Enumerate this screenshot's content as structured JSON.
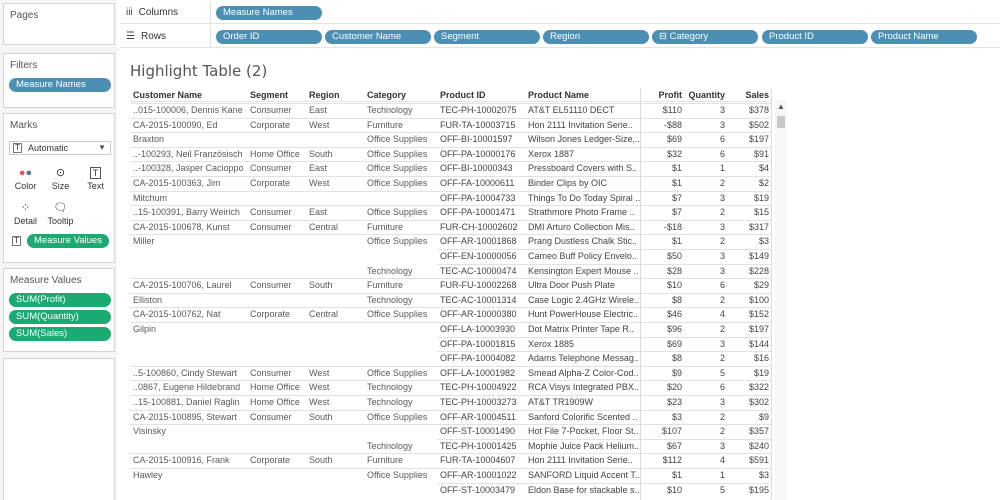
{
  "pages": {
    "title": "Pages"
  },
  "filters": {
    "title": "Filters",
    "pill": "Measure Names"
  },
  "marks": {
    "title": "Marks",
    "type": "Automatic",
    "buttons": [
      "Color",
      "Size",
      "Text",
      "Detail",
      "Tooltip"
    ],
    "pill": "Measure Values"
  },
  "measure_values": {
    "title": "Measure Values",
    "pills": [
      "SUM(Profit)",
      "SUM(Quantity)",
      "SUM(Sales)"
    ]
  },
  "columns_shelf": {
    "label": "Columns",
    "pills": [
      "Measure Names"
    ]
  },
  "rows_shelf": {
    "label": "Rows",
    "pills": [
      "Order ID",
      "Customer Name",
      "Segment",
      "Region",
      "Category",
      "Product ID",
      "Product Name"
    ]
  },
  "sheet_title": "Highlight Table (2)",
  "headers": [
    "Customer Name",
    "Segment",
    "Region",
    "Category",
    "Product ID",
    "Product Name",
    "Profit",
    "Quantity",
    "Sales"
  ],
  "rows": [
    [
      "..015-100006, Dennis Kane",
      "Consumer",
      "East",
      "Technology",
      "TEC-PH-10002075",
      "AT&T EL51110 DECT",
      "$110",
      "3",
      "$378"
    ],
    [
      "CA-2015-100090, Ed",
      "Corporate",
      "West",
      "Furniture",
      "FUR-TA-10003715",
      "Hon 2111 Invitation Serie..",
      "-$88",
      "3",
      "$502"
    ],
    [
      "Braxton",
      "",
      "",
      "Office Supplies",
      "OFF-BI-10001597",
      "Wilson Jones Ledger-Size,..",
      "$69",
      "6",
      "$197"
    ],
    [
      "..-100293, Neil Französisch",
      "Home Office",
      "South",
      "Office Supplies",
      "OFF-PA-10000176",
      "Xerox 1887",
      "$32",
      "6",
      "$91"
    ],
    [
      "..-100328, Jasper Cacioppo",
      "Consumer",
      "East",
      "Office Supplies",
      "OFF-BI-10000343",
      "Pressboard Covers with S..",
      "$1",
      "1",
      "$4"
    ],
    [
      "CA-2015-100363, Jim",
      "Corporate",
      "West",
      "Office Supplies",
      "OFF-FA-10000611",
      "Binder Clips by OIC",
      "$1",
      "2",
      "$2"
    ],
    [
      "Mitchum",
      "",
      "",
      "",
      "OFF-PA-10004733",
      "Things To Do Today Spiral ..",
      "$7",
      "3",
      "$19"
    ],
    [
      "..15-100391, Barry Weirich",
      "Consumer",
      "East",
      "Office Supplies",
      "OFF-PA-10001471",
      "Strathmore Photo Frame ..",
      "$7",
      "2",
      "$15"
    ],
    [
      "CA-2015-100678, Kunst",
      "Consumer",
      "Central",
      "Furniture",
      "FUR-CH-10002602",
      "DMI Arturo Collection Mis..",
      "-$18",
      "3",
      "$317"
    ],
    [
      "Miller",
      "",
      "",
      "Office Supplies",
      "OFF-AR-10001868",
      "Prang Dustless Chalk Stic..",
      "$1",
      "2",
      "$3"
    ],
    [
      "",
      "",
      "",
      "",
      "OFF-EN-10000056",
      "Cameo Buff Policy Envelo..",
      "$50",
      "3",
      "$149"
    ],
    [
      "",
      "",
      "",
      "Technology",
      "TEC-AC-10000474",
      "Kensington Expert Mouse ..",
      "$28",
      "3",
      "$228"
    ],
    [
      "CA-2015-100706, Laurel",
      "Consumer",
      "South",
      "Furniture",
      "FUR-FU-10002268",
      "Ultra Door Push Plate",
      "$10",
      "6",
      "$29"
    ],
    [
      "Elliston",
      "",
      "",
      "Technology",
      "TEC-AC-10001314",
      "Case Logic 2.4GHz Wirele..",
      "$8",
      "2",
      "$100"
    ],
    [
      "CA-2015-100762, Nat",
      "Corporate",
      "Central",
      "Office Supplies",
      "OFF-AR-10000380",
      "Hunt PowerHouse Electric..",
      "$46",
      "4",
      "$152"
    ],
    [
      "Gilpin",
      "",
      "",
      "",
      "OFF-LA-10003930",
      "Dot Matrix Printer Tape R..",
      "$96",
      "2",
      "$197"
    ],
    [
      "",
      "",
      "",
      "",
      "OFF-PA-10001815",
      "Xerox 1885",
      "$69",
      "3",
      "$144"
    ],
    [
      "",
      "",
      "",
      "",
      "OFF-PA-10004082",
      "Adams Telephone Messag..",
      "$8",
      "2",
      "$16"
    ],
    [
      "..5-100860, Cindy Stewart",
      "Consumer",
      "West",
      "Office Supplies",
      "OFF-LA-10001982",
      "Smead Alpha-Z Color-Cod..",
      "$9",
      "5",
      "$19"
    ],
    [
      "..0867, Eugene Hildebrand",
      "Home Office",
      "West",
      "Technology",
      "TEC-PH-10004922",
      "RCA Visys Integrated PBX..",
      "$20",
      "6",
      "$322"
    ],
    [
      "..15-100881, Daniel Raglin",
      "Home Office",
      "West",
      "Technology",
      "TEC-PH-10003273",
      "AT&T TR1909W",
      "$23",
      "3",
      "$302"
    ],
    [
      "CA-2015-100895, Stewart",
      "Consumer",
      "South",
      "Office Supplies",
      "OFF-AR-10004511",
      "Sanford Colorific Scented ..",
      "$3",
      "2",
      "$9"
    ],
    [
      "Visinsky",
      "",
      "",
      "",
      "OFF-ST-10001490",
      "Hot File 7-Pocket, Floor St..",
      "$107",
      "2",
      "$357"
    ],
    [
      "",
      "",
      "",
      "Technology",
      "TEC-PH-10001425",
      "Mophie Juice Pack Helium..",
      "$67",
      "3",
      "$240"
    ],
    [
      "CA-2015-100916, Frank",
      "Corporate",
      "South",
      "Furniture",
      "FUR-TA-10004607",
      "Hon 2111 Invitation Serie..",
      "$112",
      "4",
      "$591"
    ],
    [
      "Hawley",
      "",
      "",
      "Office Supplies",
      "OFF-AR-10001022",
      "SANFORD Liquid Accent T..",
      "$1",
      "1",
      "$3"
    ],
    [
      "",
      "",
      "",
      "",
      "OFF-ST-10003479",
      "Eldon Base for stackable s..",
      "$10",
      "5",
      "$195"
    ]
  ]
}
